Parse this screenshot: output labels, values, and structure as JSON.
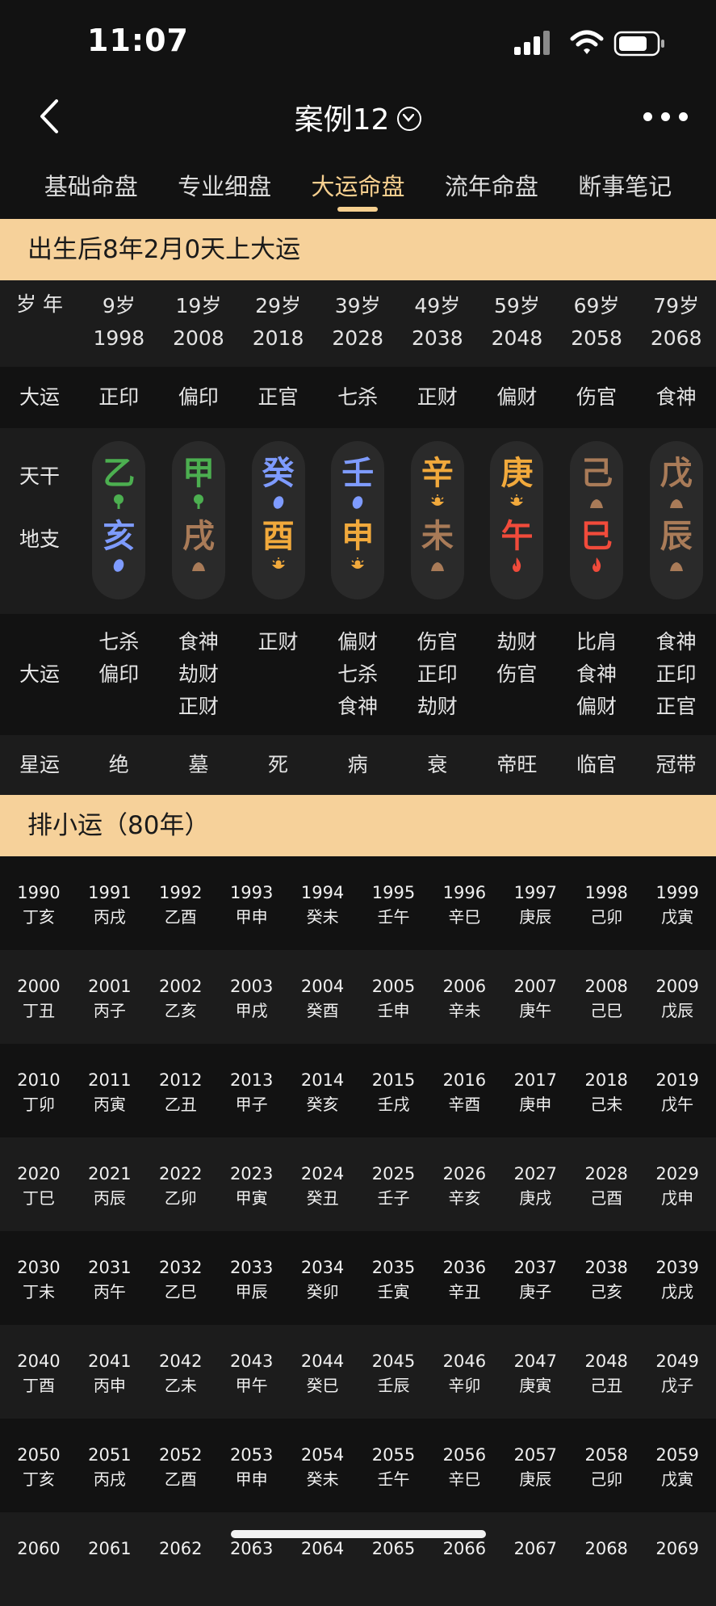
{
  "status": {
    "time": "11:07"
  },
  "nav": {
    "title": "案例12"
  },
  "tabs": [
    "基础命盘",
    "专业细盘",
    "大运命盘",
    "流年命盘",
    "断事笔记"
  ],
  "active_tab": 2,
  "banner1": "出生后8年2月0天上大运",
  "grid": {
    "age_label": "岁",
    "year_label": "年",
    "ages": [
      "9岁",
      "19岁",
      "29岁",
      "39岁",
      "49岁",
      "59岁",
      "69岁",
      "79岁"
    ],
    "years": [
      "1998",
      "2008",
      "2018",
      "2028",
      "2038",
      "2048",
      "2058",
      "2068"
    ],
    "dayun_label": "大运",
    "dayun_gods": [
      "正印",
      "偏印",
      "正官",
      "七杀",
      "正财",
      "偏财",
      "伤官",
      "食神"
    ],
    "tiangan_label": "天干",
    "dizhi_label": "地支",
    "gan": [
      "乙",
      "甲",
      "癸",
      "壬",
      "辛",
      "庚",
      "己",
      "戊"
    ],
    "gan_colors": [
      "#4caf50",
      "#4caf50",
      "#7e9bff",
      "#7e9bff",
      "#f1a93c",
      "#f1a93c",
      "#a97b58",
      "#a97b58"
    ],
    "gan_icons": [
      "tree-icon",
      "tree-icon",
      "water-drop-icon",
      "water-drop-icon",
      "gold-ingot-icon",
      "gold-ingot-icon",
      "earth-rock-icon",
      "earth-rock-icon"
    ],
    "zhi": [
      "亥",
      "戌",
      "酉",
      "申",
      "未",
      "午",
      "巳",
      "辰"
    ],
    "zhi_colors": [
      "#7e9bff",
      "#a97b58",
      "#f1a93c",
      "#f1a93c",
      "#a97b58",
      "#f14b3b",
      "#f14b3b",
      "#a97b58"
    ],
    "zhi_icons": [
      "water-drop-icon",
      "earth-rock-icon",
      "gold-ingot-icon",
      "gold-ingot-icon",
      "earth-rock-icon",
      "fire-icon",
      "fire-icon",
      "earth-rock-icon"
    ],
    "hidden_label": "大运",
    "hidden": [
      [
        "七杀",
        "偏印"
      ],
      [
        "食神",
        "劫财",
        "正财"
      ],
      [
        "正财"
      ],
      [
        "偏财",
        "七杀",
        "食神"
      ],
      [
        "伤官",
        "正印",
        "劫财"
      ],
      [
        "劫财",
        "伤官"
      ],
      [
        "比肩",
        "食神",
        "偏财"
      ],
      [
        "食神",
        "正印",
        "正官"
      ]
    ],
    "xingyun_label": "星运",
    "xingyun": [
      "绝",
      "墓",
      "死",
      "病",
      "衰",
      "帝旺",
      "临官",
      "冠带"
    ]
  },
  "banner2": "排小运（80年）",
  "xiaoyun": [
    {
      "years": [
        "1990",
        "1991",
        "1992",
        "1993",
        "1994",
        "1995",
        "1996",
        "1997",
        "1998",
        "1999"
      ],
      "gz": [
        "丁亥",
        "丙戌",
        "乙酉",
        "甲申",
        "癸未",
        "壬午",
        "辛巳",
        "庚辰",
        "己卯",
        "戊寅"
      ]
    },
    {
      "years": [
        "2000",
        "2001",
        "2002",
        "2003",
        "2004",
        "2005",
        "2006",
        "2007",
        "2008",
        "2009"
      ],
      "gz": [
        "丁丑",
        "丙子",
        "乙亥",
        "甲戌",
        "癸酉",
        "壬申",
        "辛未",
        "庚午",
        "己巳",
        "戊辰"
      ]
    },
    {
      "years": [
        "2010",
        "2011",
        "2012",
        "2013",
        "2014",
        "2015",
        "2016",
        "2017",
        "2018",
        "2019"
      ],
      "gz": [
        "丁卯",
        "丙寅",
        "乙丑",
        "甲子",
        "癸亥",
        "壬戌",
        "辛酉",
        "庚申",
        "己未",
        "戊午"
      ]
    },
    {
      "years": [
        "2020",
        "2021",
        "2022",
        "2023",
        "2024",
        "2025",
        "2026",
        "2027",
        "2028",
        "2029"
      ],
      "gz": [
        "丁巳",
        "丙辰",
        "乙卯",
        "甲寅",
        "癸丑",
        "壬子",
        "辛亥",
        "庚戌",
        "己酉",
        "戊申"
      ]
    },
    {
      "years": [
        "2030",
        "2031",
        "2032",
        "2033",
        "2034",
        "2035",
        "2036",
        "2037",
        "2038",
        "2039"
      ],
      "gz": [
        "丁未",
        "丙午",
        "乙巳",
        "甲辰",
        "癸卯",
        "壬寅",
        "辛丑",
        "庚子",
        "己亥",
        "戊戌"
      ]
    },
    {
      "years": [
        "2040",
        "2041",
        "2042",
        "2043",
        "2044",
        "2045",
        "2046",
        "2047",
        "2048",
        "2049"
      ],
      "gz": [
        "丁酉",
        "丙申",
        "乙未",
        "甲午",
        "癸巳",
        "壬辰",
        "辛卯",
        "庚寅",
        "己丑",
        "戊子"
      ]
    },
    {
      "years": [
        "2050",
        "2051",
        "2052",
        "2053",
        "2054",
        "2055",
        "2056",
        "2057",
        "2058",
        "2059"
      ],
      "gz": [
        "丁亥",
        "丙戌",
        "乙酉",
        "甲申",
        "癸未",
        "壬午",
        "辛巳",
        "庚辰",
        "己卯",
        "戊寅"
      ]
    },
    {
      "years": [
        "2060",
        "2061",
        "2062",
        "2063",
        "2064",
        "2065",
        "2066",
        "2067",
        "2068",
        "2069"
      ],
      "gz": [
        "",
        "",
        "",
        "",
        "",
        "",
        "",
        "",
        "",
        ""
      ]
    }
  ]
}
